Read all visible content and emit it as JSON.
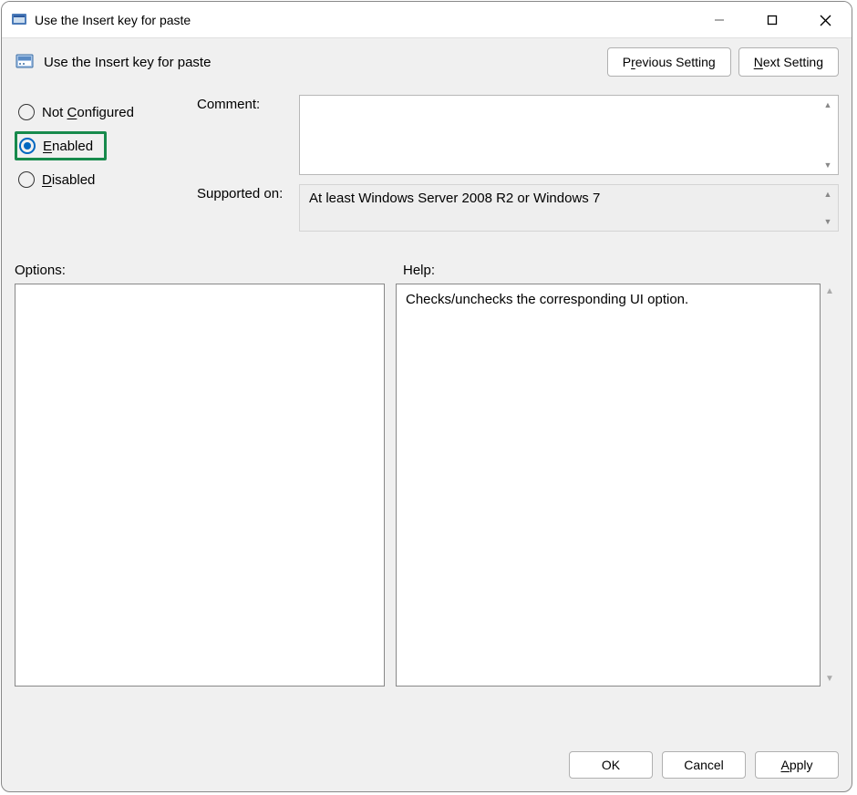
{
  "window": {
    "title": "Use the Insert key for paste"
  },
  "header": {
    "title": "Use the Insert key for paste",
    "prev_label_pre": "P",
    "prev_label_u": "r",
    "prev_label_post": "evious Setting",
    "next_label_pre": "",
    "next_label_u": "N",
    "next_label_post": "ext Setting"
  },
  "radios": {
    "not_configured_pre": "Not ",
    "not_configured_u": "C",
    "not_configured_post": "onfigured",
    "enabled_pre": "",
    "enabled_u": "E",
    "enabled_post": "nabled",
    "disabled_pre": "",
    "disabled_u": "D",
    "disabled_post": "isabled",
    "selected": "enabled"
  },
  "fields": {
    "comment_label": "Comment:",
    "comment_value": "",
    "supported_label": "Supported on:",
    "supported_value": "At least Windows Server 2008 R2 or Windows 7"
  },
  "panels": {
    "options_label": "Options:",
    "help_label": "Help:",
    "help_text": "Checks/unchecks the corresponding UI option."
  },
  "buttons": {
    "ok": "OK",
    "cancel": "Cancel",
    "apply_u": "A",
    "apply_post": "pply"
  }
}
